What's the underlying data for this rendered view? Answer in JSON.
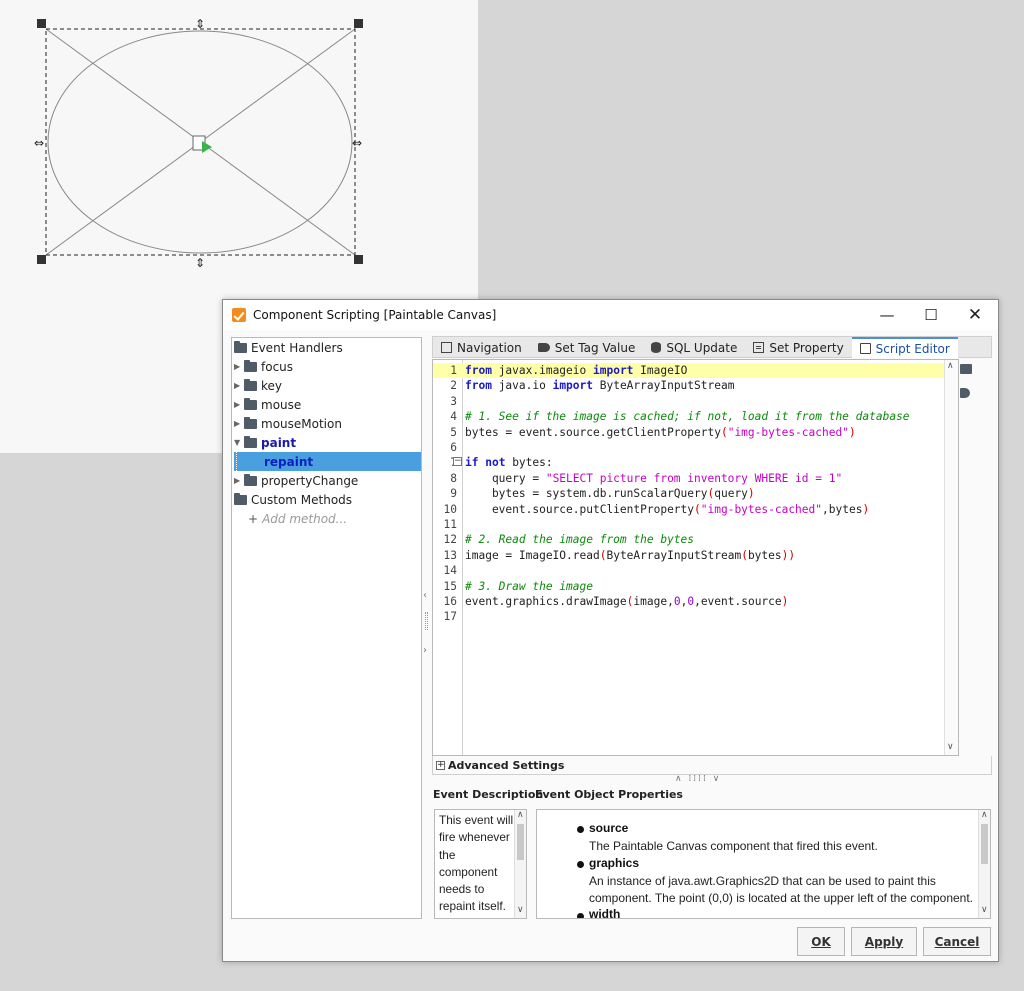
{
  "dialog": {
    "title": "Component Scripting [Paintable Canvas]",
    "window_controls": {
      "minimize": "—",
      "maximize": "☐",
      "close": "✕"
    }
  },
  "tree": {
    "root_label": "Event Handlers",
    "items": [
      {
        "label": "focus"
      },
      {
        "label": "key"
      },
      {
        "label": "mouse"
      },
      {
        "label": "mouseMotion"
      },
      {
        "label": "paint"
      },
      {
        "label": "repaint"
      },
      {
        "label": "propertyChange"
      }
    ],
    "custom_methods_label": "Custom Methods",
    "add_method_label": "Add method..."
  },
  "tabs": [
    {
      "label": "Navigation",
      "icon": "navigation-icon"
    },
    {
      "label": "Set Tag Value",
      "icon": "tag-icon"
    },
    {
      "label": "SQL Update",
      "icon": "database-icon"
    },
    {
      "label": "Set Property",
      "icon": "property-icon"
    },
    {
      "label": "Script Editor",
      "icon": "script-icon",
      "active": true
    }
  ],
  "code": {
    "line_numbers": [
      "1",
      "2",
      "3",
      "4",
      "5",
      "6",
      "7",
      "8",
      "9",
      "10",
      "11",
      "12",
      "13",
      "14",
      "15",
      "16",
      "17"
    ],
    "lines": [
      [
        "from",
        " javax.imageio ",
        "import",
        " ImageIO"
      ],
      [
        "from",
        " java.io ",
        "import",
        " ByteArrayInputStream"
      ],
      [],
      [
        "# 1. See if the image is cached; if not, load it from the database"
      ],
      [
        "bytes = event.source.getClientProperty",
        "(",
        "\"img-bytes-cached\"",
        ")"
      ],
      [],
      [
        "if",
        " ",
        "not",
        " bytes:"
      ],
      [
        "    query = ",
        "\"SELECT picture from inventory WHERE id = 1\""
      ],
      [
        "    bytes = system.db.runScalarQuery",
        "(",
        "query",
        ")"
      ],
      [
        "    event.source.putClientProperty",
        "(",
        "\"img-bytes-cached\"",
        ",bytes",
        ")"
      ],
      [],
      [
        "# 2. Read the image from the bytes"
      ],
      [
        "image = ImageIO.read",
        "(",
        "ByteArrayInputStream",
        "(",
        "bytes",
        "))"
      ],
      [],
      [
        "# 3. Draw the image"
      ],
      [
        "event.graphics.drawImage",
        "(",
        "image,",
        "0",
        ",",
        "0",
        ",event.source",
        ")"
      ],
      []
    ]
  },
  "advanced_settings_label": "Advanced Settings",
  "event_description": {
    "title": "Event Description",
    "text": "This event will fire whenever the component needs to repaint itself. Implement painting code"
  },
  "event_object_properties": {
    "title": "Event Object Properties",
    "properties": [
      {
        "name": "source",
        "description": "The Paintable Canvas component that fired this event."
      },
      {
        "name": "graphics",
        "description": "An instance of java.awt.Graphics2D that can be used to paint this component. The point (0,0) is located at the upper left of the component."
      },
      {
        "name": "width",
        "description": ""
      }
    ]
  },
  "buttons": {
    "ok": "OK",
    "apply": "Apply",
    "cancel": "Cancel"
  }
}
